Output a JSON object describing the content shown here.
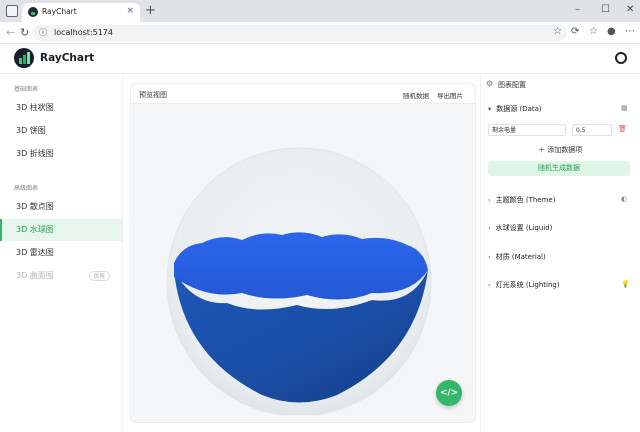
{
  "browser": {
    "tab_title": "RayChart",
    "tab_close": "×",
    "new_tab": "+",
    "url": "localhost:5174",
    "window_controls": {
      "minimize": "–",
      "maximize": "☐",
      "close": "✕"
    },
    "icons": [
      "back-icon",
      "forward-icon",
      "reload-icon",
      "site-info-icon",
      "star-icon",
      "extension-icon",
      "split-screen-icon",
      "favorites-icon",
      "profile-icon",
      "more-icon"
    ]
  },
  "app": {
    "title": "RayChart"
  },
  "sidebar": {
    "sections": [
      {
        "title": "基础图表",
        "items": [
          {
            "label": "3D 柱状图"
          },
          {
            "label": "3D 饼图"
          },
          {
            "label": "3D 折线图"
          }
        ]
      },
      {
        "title": "高级图表",
        "items": [
          {
            "label": "3D 散点图"
          },
          {
            "label": "3D 水球图",
            "active": true
          },
          {
            "label": "3D 雷达图"
          },
          {
            "label": "3D 曲面图",
            "disabled": true,
            "badge": "即将"
          }
        ]
      }
    ]
  },
  "preview": {
    "title": "预览视图",
    "actions": {
      "random": "随机数据",
      "export": "导出图片"
    },
    "liquid": {
      "value": 0.5,
      "color": "#2f6fe0"
    },
    "code_button": "</>"
  },
  "config": {
    "title": "图表配置",
    "data_source": {
      "title": "数据源 (Data)",
      "items": [
        {
          "name": "剩余电量",
          "value": "0.5"
        }
      ],
      "add_label": "添加数据项",
      "random_label": "随机生成数据"
    },
    "sections": [
      {
        "title": "主题颜色 (Theme)"
      },
      {
        "title": "水球设置 (Liquid)"
      },
      {
        "title": "材质 (Material)"
      },
      {
        "title": "灯光系统 (Lighting)"
      }
    ]
  },
  "colors": {
    "accent": "#36b866",
    "liquid": "#2f6fe0",
    "liquid_top": "#2b63ea"
  }
}
